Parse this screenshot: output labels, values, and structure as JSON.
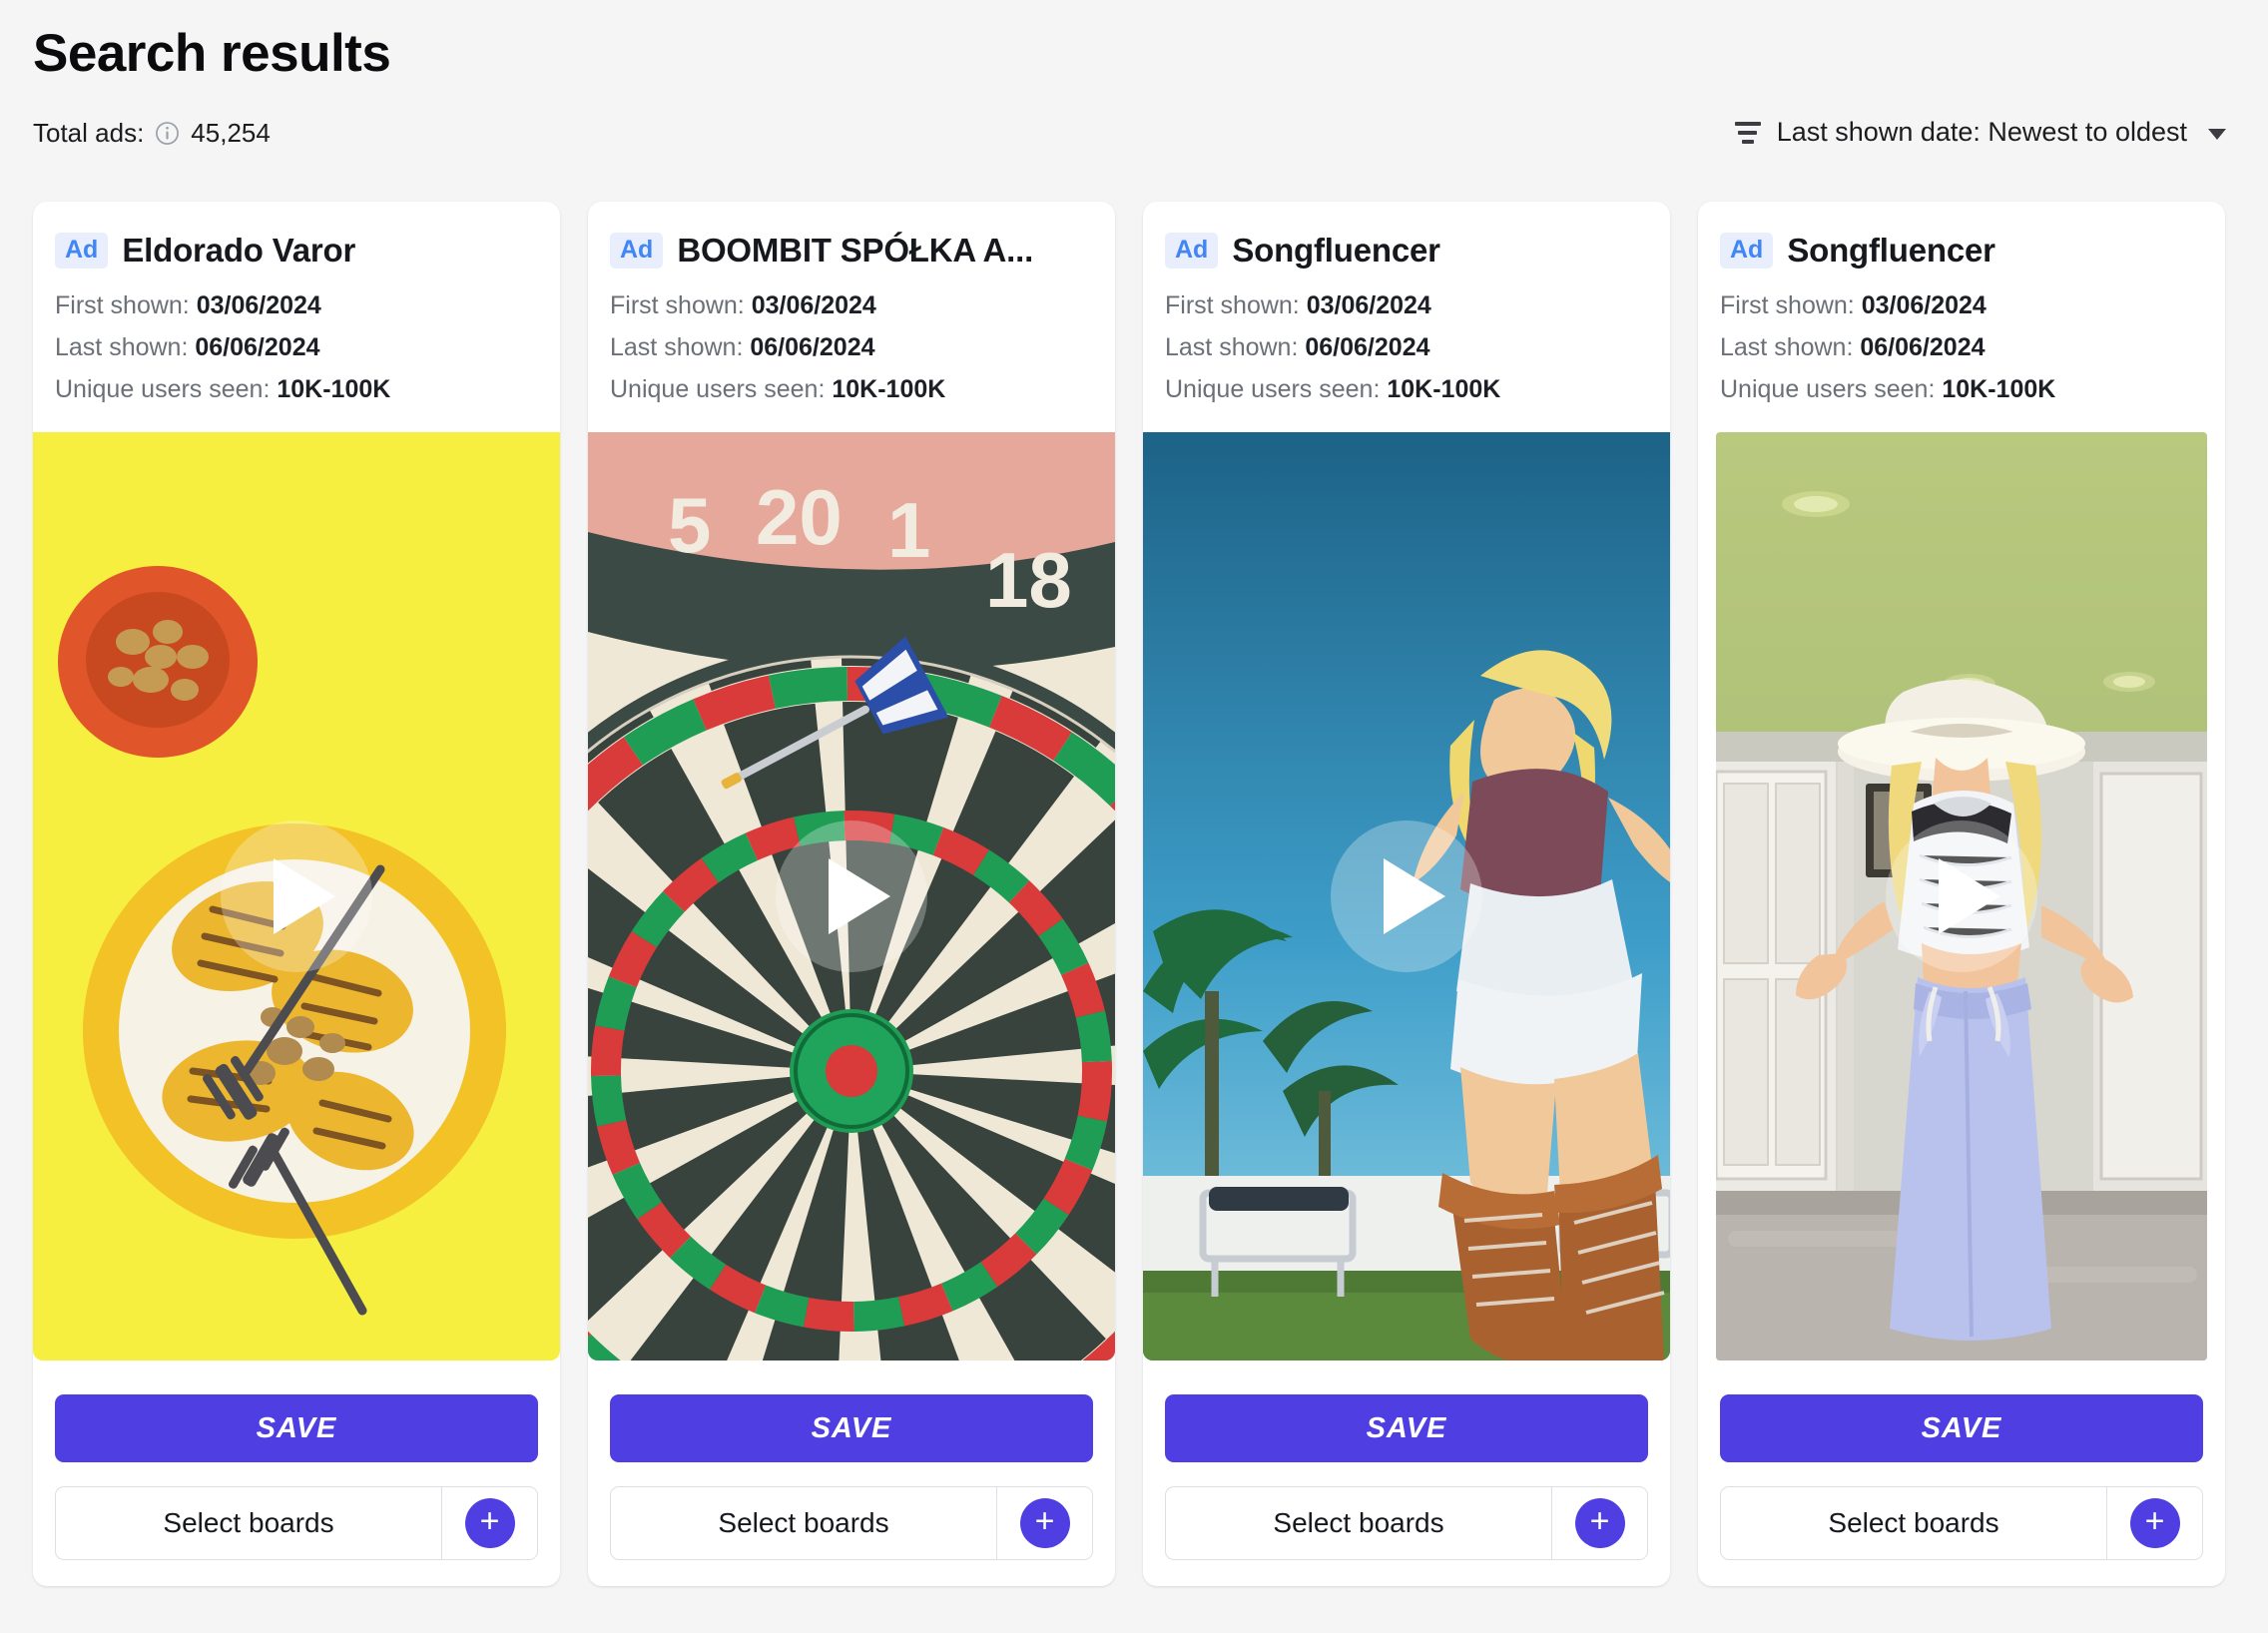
{
  "header": {
    "title": "Search results",
    "total_ads_label": "Total ads:",
    "total_ads_value": "45,254",
    "info_icon": "info-circle-icon",
    "sort": {
      "icon": "sort-lines-icon",
      "label": "Last shown date: Newest to oldest",
      "caret_icon": "chevron-down-icon"
    }
  },
  "labels": {
    "ad_badge": "Ad",
    "first_shown": "First shown:",
    "last_shown": "Last shown:",
    "unique_users": "Unique users seen:",
    "save": "SAVE",
    "select_boards": "Select boards",
    "add_board": "+",
    "play": "play-icon"
  },
  "colors": {
    "accent_purple": "#4f3fe2",
    "ad_badge_bg": "#e8eefc",
    "ad_badge_text": "#4285f4",
    "page_bg": "#f5f5f6",
    "card_bg": "#ffffff",
    "muted_text": "#6b6f76"
  },
  "cards": [
    {
      "advertiser": "Eldorado Varor",
      "first_shown": "03/06/2024",
      "last_shown": "06/06/2024",
      "unique_users_seen": "10K-100K",
      "thumbnail": "grilled-peach-dessert-on-yellow-background",
      "thumb_inset": false
    },
    {
      "advertiser": "BOOMBIT SPÓŁKA A...",
      "first_shown": "03/06/2024",
      "last_shown": "06/06/2024",
      "unique_users_seen": "10K-100K",
      "thumbnail": "dartboard-with-dart",
      "thumb_inset": false
    },
    {
      "advertiser": "Songfluencer",
      "first_shown": "03/06/2024",
      "last_shown": "06/06/2024",
      "unique_users_seen": "10K-100K",
      "thumbnail": "woman-outdoors-blue-sky-palm-trees",
      "thumb_inset": true
    },
    {
      "advertiser": "Songfluencer",
      "first_shown": "03/06/2024",
      "last_shown": "06/06/2024",
      "unique_users_seen": "10K-100K",
      "thumbnail": "woman-in-cowboy-hat-indoors-green-ceiling",
      "thumb_inset": true
    }
  ]
}
